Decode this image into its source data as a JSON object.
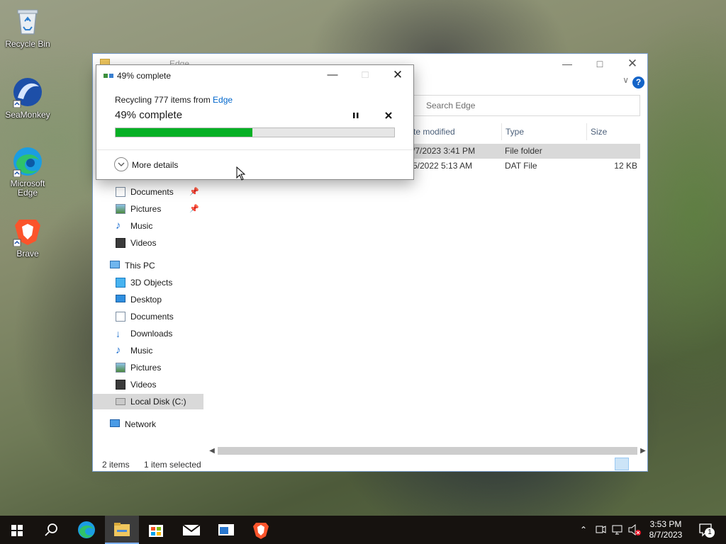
{
  "desktop": {
    "icons": [
      {
        "label": "Recycle Bin",
        "icon": "recycle-bin-icon"
      },
      {
        "label": "SeaMonkey",
        "icon": "seamonkey-icon"
      },
      {
        "label": "Microsoft Edge",
        "icon": "edge-icon"
      },
      {
        "label": "Brave",
        "icon": "brave-icon"
      }
    ]
  },
  "explorer": {
    "title": "Edge",
    "search_placeholder": "Search Edge",
    "columns": {
      "date": "te modified",
      "type": "Type",
      "size": "Size"
    },
    "rows": [
      {
        "date": "/7/2023 3:41 PM",
        "type": "File folder",
        "size": "",
        "selected": true
      },
      {
        "date": "5/2022 5:13 AM",
        "type": "DAT File",
        "size": "12 KB",
        "selected": false
      }
    ],
    "nav": {
      "quick": [
        {
          "label": "Documents",
          "pinned": true,
          "icon": "documents-icon"
        },
        {
          "label": "Pictures",
          "pinned": true,
          "icon": "pictures-icon"
        },
        {
          "label": "Music",
          "pinned": false,
          "icon": "music-icon"
        },
        {
          "label": "Videos",
          "pinned": false,
          "icon": "videos-icon"
        }
      ],
      "this_pc": "This PC",
      "pc_items": [
        {
          "label": "3D Objects",
          "icon": "3d-objects-icon"
        },
        {
          "label": "Desktop",
          "icon": "desktop-icon"
        },
        {
          "label": "Documents",
          "icon": "documents-icon"
        },
        {
          "label": "Downloads",
          "icon": "downloads-icon"
        },
        {
          "label": "Music",
          "icon": "music-icon"
        },
        {
          "label": "Pictures",
          "icon": "pictures-icon"
        },
        {
          "label": "Videos",
          "icon": "videos-icon"
        },
        {
          "label": "Local Disk (C:)",
          "icon": "local-disk-icon",
          "active": true
        }
      ],
      "network": "Network"
    },
    "status": {
      "items": "2 items",
      "selected": "1 item selected"
    }
  },
  "dialog": {
    "title": "49% complete",
    "recycling_prefix": "Recycling 777 items from ",
    "source_link": "Edge",
    "heading": "49% complete",
    "progress": 0.49,
    "more_details": "More details",
    "accent": "#06b025",
    "link_color": "#0066cc"
  },
  "taskbar": {
    "time": "3:53 PM",
    "date": "8/7/2023",
    "notification_count": "1"
  }
}
